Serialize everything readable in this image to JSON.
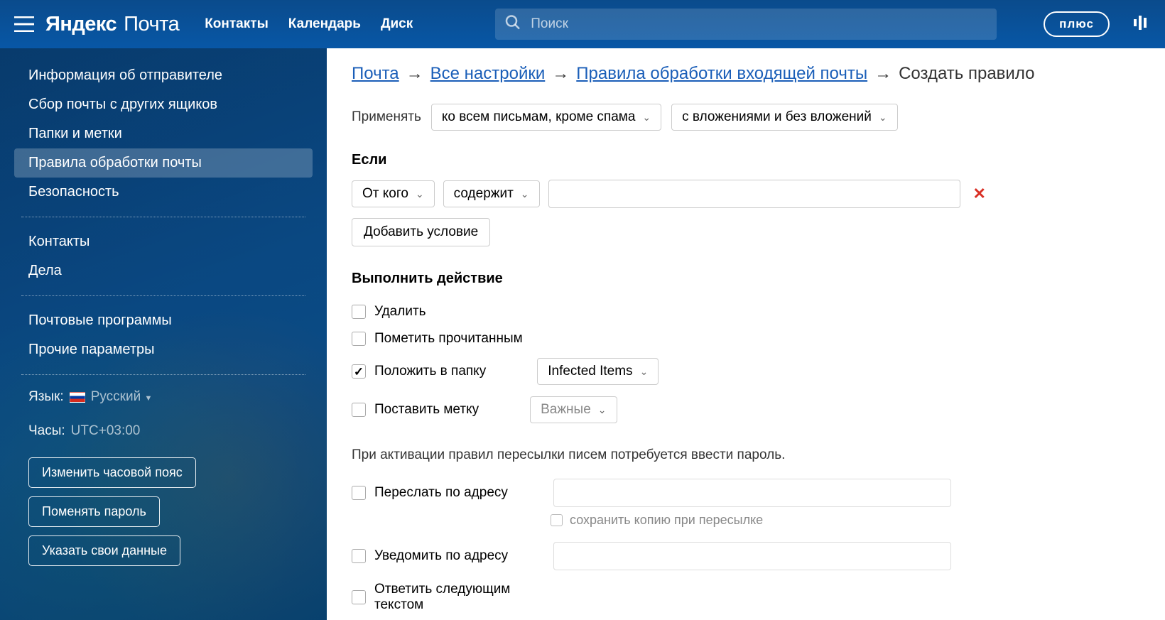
{
  "header": {
    "logo_brand": "Яндекс",
    "logo_product": "Почта",
    "nav": {
      "contacts": "Контакты",
      "calendar": "Календарь",
      "disk": "Диск"
    },
    "search_placeholder": "Поиск",
    "plus_btn": "плюс"
  },
  "sidebar": {
    "items": [
      "Информация об отправителе",
      "Сбор почты с других ящиков",
      "Папки и метки",
      "Правила обработки почты",
      "Безопасность"
    ],
    "group2": [
      "Контакты",
      "Дела"
    ],
    "group3": [
      "Почтовые программы",
      "Прочие параметры"
    ],
    "lang_label": "Язык:",
    "lang_value": "Русский",
    "clock_label": "Часы:",
    "clock_value": "UTC+03:00",
    "btns": {
      "tz": "Изменить часовой пояс",
      "pass": "Поменять пароль",
      "data": "Указать свои данные"
    }
  },
  "breadcrumb": {
    "bc1": "Почта",
    "bc2": "Все настройки",
    "bc3": "Правила обработки входящей почты",
    "bc4": "Создать правило"
  },
  "apply": {
    "label": "Применять",
    "scope": "ко всем письмам, кроме спама",
    "attach": "с вложениями и без вложений"
  },
  "if_section": {
    "title": "Если",
    "field": "От кого",
    "op": "содержит",
    "add": "Добавить условие"
  },
  "action_section": {
    "title": "Выполнить действие",
    "delete": "Удалить",
    "mark_read": "Пометить прочитанным",
    "move": "Положить в папку",
    "move_folder": "Infected Items",
    "label": "Поставить метку",
    "label_val": "Важные"
  },
  "forward": {
    "note": "При активации правил пересылки писем потребуется ввести пароль.",
    "fwd": "Переслать по адресу",
    "keep_copy": "сохранить копию при пересылке",
    "notify": "Уведомить по адресу",
    "reply": "Ответить следующим текстом"
  }
}
